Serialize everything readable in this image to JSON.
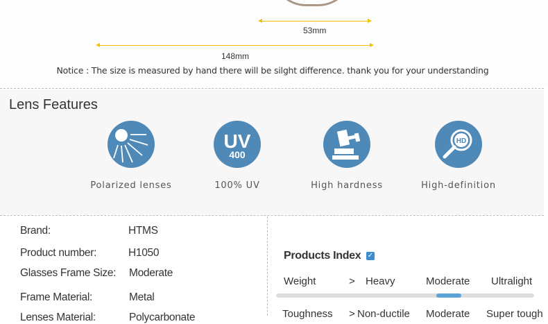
{
  "dimensions": {
    "lens_width_label": "53mm",
    "total_width_label": "148mm",
    "notice": "Notice : The size is measured by hand there will be silght difference. thank you for your understanding"
  },
  "lens_features": {
    "title": "Lens Features",
    "items": [
      {
        "label": "Polarized lenses",
        "icon": "polarized-icon"
      },
      {
        "label": "100% UV",
        "icon": "uv400-icon",
        "icon_text_main": "UV",
        "icon_text_sub": "400"
      },
      {
        "label": "High hardness",
        "icon": "gavel-icon"
      },
      {
        "label": "High-definition",
        "icon": "hd-magnifier-icon",
        "icon_text": "HD"
      }
    ],
    "icon_color": "#4f89b8"
  },
  "specs": {
    "rows": [
      {
        "key": "Brand:",
        "value": "HTMS"
      },
      {
        "key": "Product number:",
        "value": "H1050"
      },
      {
        "key": "Glasses Frame Size:",
        "value": "Moderate"
      },
      {
        "key": "Frame Material:",
        "value": "Metal"
      },
      {
        "key": "Lenses Material:",
        "value": "Polycarbonate"
      }
    ]
  },
  "products_index": {
    "title": "Products Index",
    "weight": {
      "label": "Weight",
      "arrow": ">",
      "levels": [
        "Heavy",
        "Moderate",
        "Ultralight"
      ],
      "selected": "Moderate"
    },
    "toughness": {
      "label": "Toughness",
      "arrow": ">",
      "levels": [
        "Non-ductile",
        "Moderate",
        "Super tough"
      ]
    },
    "accent_color": "#5ba4d8"
  }
}
